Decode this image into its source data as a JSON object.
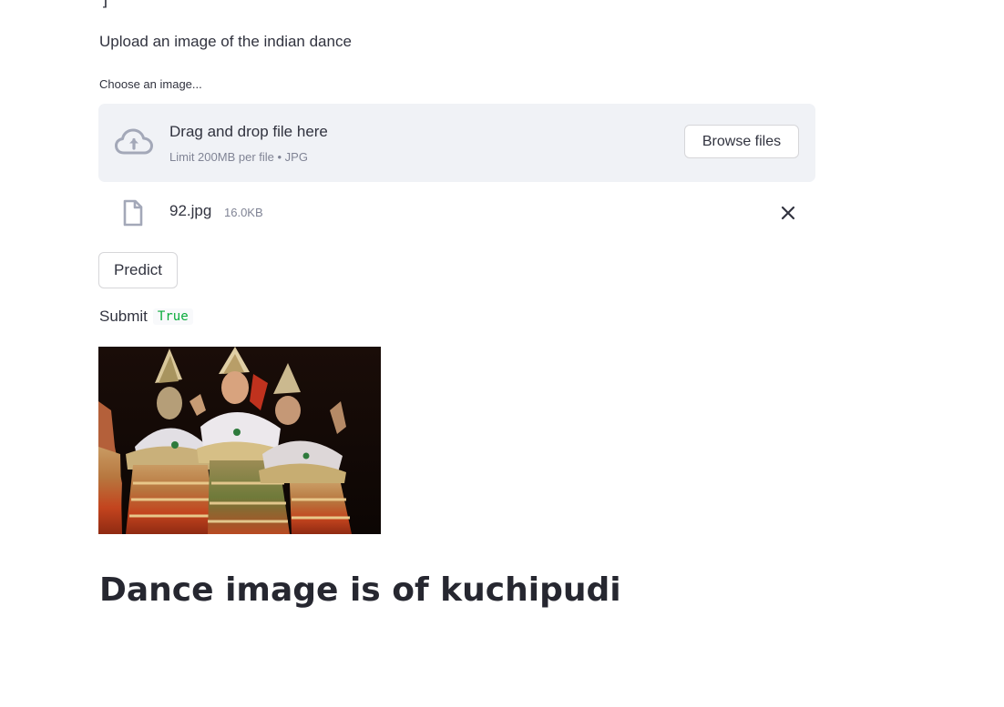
{
  "top_fragment": "]",
  "intro": {
    "text": "Upload an image of the indian dance"
  },
  "uploader": {
    "label": "Choose an image...",
    "drop_title": "Drag and drop file here",
    "drop_limit": "Limit 200MB per file • JPG",
    "browse_label": "Browse files",
    "upload_icon": "cloud-upload-icon"
  },
  "uploaded_file": {
    "name": "92.jpg",
    "size": "16.0KB",
    "file_icon": "file-icon",
    "remove_icon": "close-icon"
  },
  "predict_button": {
    "label": "Predict"
  },
  "submit_status": {
    "label": "Submit",
    "value": "True"
  },
  "result": {
    "heading": "Dance image is of kuchipudi"
  },
  "colors": {
    "dropzone_bg": "#f0f2f6",
    "muted_text": "#808495",
    "code_green": "#09ab3b",
    "icon_gray": "#a3a8b8"
  }
}
